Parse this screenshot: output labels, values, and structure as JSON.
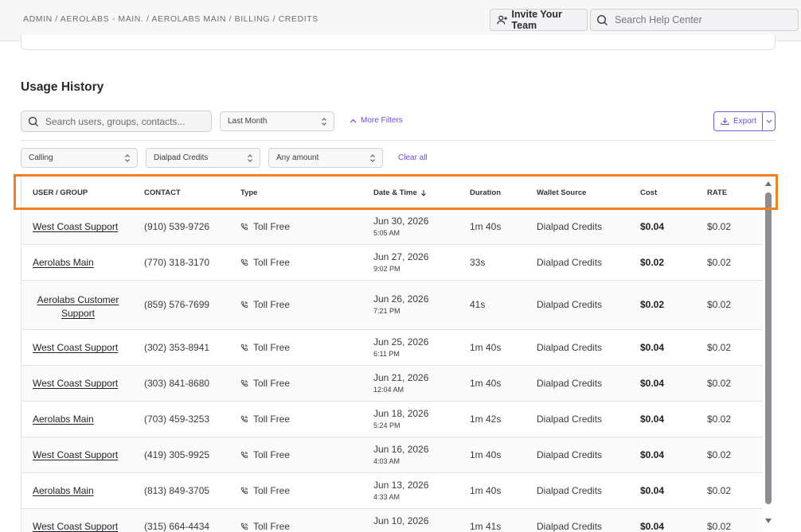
{
  "header": {
    "breadcrumb": "ADMIN / AEROLABS - MAIN. / AEROLABS MAIN / BILLING / CREDITS",
    "invite_label": "Invite Your Team",
    "help_search_placeholder": "Search Help Center"
  },
  "page": {
    "title": "Usage History"
  },
  "filters": {
    "search_placeholder": "Search users, groups, contacts...",
    "period": "Last Month",
    "more_filters_label": "More Filters",
    "export_label": "Export",
    "category": "Calling",
    "wallet": "Dialpad Credits",
    "amount": "Any amount",
    "clear_all_label": "Clear all"
  },
  "table": {
    "columns": {
      "user": "USER / GROUP",
      "contact": "CONTACT",
      "type": "Type",
      "datetime": "Date & Time",
      "duration": "Duration",
      "wallet": "Wallet Source",
      "cost": "Cost",
      "rate": "RATE"
    },
    "rows": [
      {
        "user": "West Coast Support",
        "contact": "(910) 539-9726",
        "type": "Toll Free",
        "date": "Jun 30, 2026",
        "time": "5:05 AM",
        "duration": "1m 40s",
        "wallet": "Dialpad Credits",
        "cost": "$0.04",
        "rate": "$0.02"
      },
      {
        "user": "Aerolabs Main",
        "contact": "(770) 318-3170",
        "type": "Toll Free",
        "date": "Jun 27, 2026",
        "time": "9:02 PM",
        "duration": "33s",
        "wallet": "Dialpad Credits",
        "cost": "$0.02",
        "rate": "$0.02"
      },
      {
        "user": "Aerolabs Customer Support",
        "contact": "(859) 576-7699",
        "type": "Toll Free",
        "date": "Jun 26, 2026",
        "time": "7:21 PM",
        "duration": "41s",
        "wallet": "Dialpad Credits",
        "cost": "$0.02",
        "rate": "$0.02"
      },
      {
        "user": "West Coast Support",
        "contact": "(302) 353-8941",
        "type": "Toll Free",
        "date": "Jun 25, 2026",
        "time": "6:11 PM",
        "duration": "1m 40s",
        "wallet": "Dialpad Credits",
        "cost": "$0.04",
        "rate": "$0.02"
      },
      {
        "user": "West Coast Support",
        "contact": "(303) 841-8680",
        "type": "Toll Free",
        "date": "Jun 21, 2026",
        "time": "12:04 AM",
        "duration": "1m 40s",
        "wallet": "Dialpad Credits",
        "cost": "$0.04",
        "rate": "$0.02"
      },
      {
        "user": "Aerolabs Main",
        "contact": "(703) 459-3253",
        "type": "Toll Free",
        "date": "Jun 18, 2026",
        "time": "5:24 PM",
        "duration": "1m 42s",
        "wallet": "Dialpad Credits",
        "cost": "$0.04",
        "rate": "$0.02"
      },
      {
        "user": "West Coast Support",
        "contact": "(419) 305-9925",
        "type": "Toll Free",
        "date": "Jun 16, 2026",
        "time": "4:03 AM",
        "duration": "1m 40s",
        "wallet": "Dialpad Credits",
        "cost": "$0.04",
        "rate": "$0.02"
      },
      {
        "user": "Aerolabs Main",
        "contact": "(813) 849-3705",
        "type": "Toll Free",
        "date": "Jun 13, 2026",
        "time": "4:33 AM",
        "duration": "1m 40s",
        "wallet": "Dialpad Credits",
        "cost": "$0.04",
        "rate": "$0.02"
      },
      {
        "user": "West Coast Support",
        "contact": "(315) 664-4434",
        "type": "Toll Free",
        "date": "Jun 10, 2026",
        "time": "",
        "duration": "1m 41s",
        "wallet": "Dialpad Credits",
        "cost": "$0.04",
        "rate": "$0.02"
      }
    ]
  },
  "colors": {
    "accent": "#6d4bd8",
    "highlight": "#f47e22"
  }
}
